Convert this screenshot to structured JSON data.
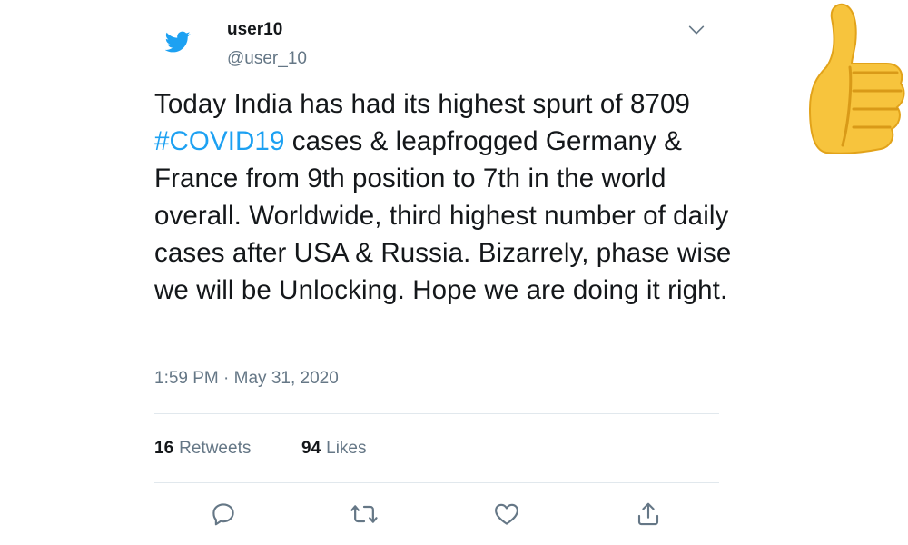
{
  "tweet": {
    "display_name": "user10",
    "handle": "@user_10",
    "text_parts": {
      "before": "Today India has had its highest spurt of 8709 ",
      "hashtag": "#COVID19",
      "after": " cases & leapfrogged Germany & France from 9th position to 7th in the world overall. Worldwide, third highest number of daily cases after USA & Russia. Bizarrely, phase wise we will be Unlocking. Hope we are doing it right."
    },
    "timestamp": "1:59 PM · May 31, 2020",
    "retweets_count": "16",
    "retweets_label": "Retweets",
    "likes_count": "94",
    "likes_label": "Likes"
  },
  "icons": {
    "logo": "twitter-bird-icon",
    "menu": "chevron-down-icon",
    "reply": "reply-icon",
    "retweet": "retweet-icon",
    "like": "heart-icon",
    "share": "share-icon",
    "sticker": "thumbs-up-icon"
  },
  "colors": {
    "brand": "#1da1f2",
    "text": "#14171a",
    "muted": "#657786",
    "divider": "#e1e8ed",
    "thumb": "#f7c43d"
  }
}
